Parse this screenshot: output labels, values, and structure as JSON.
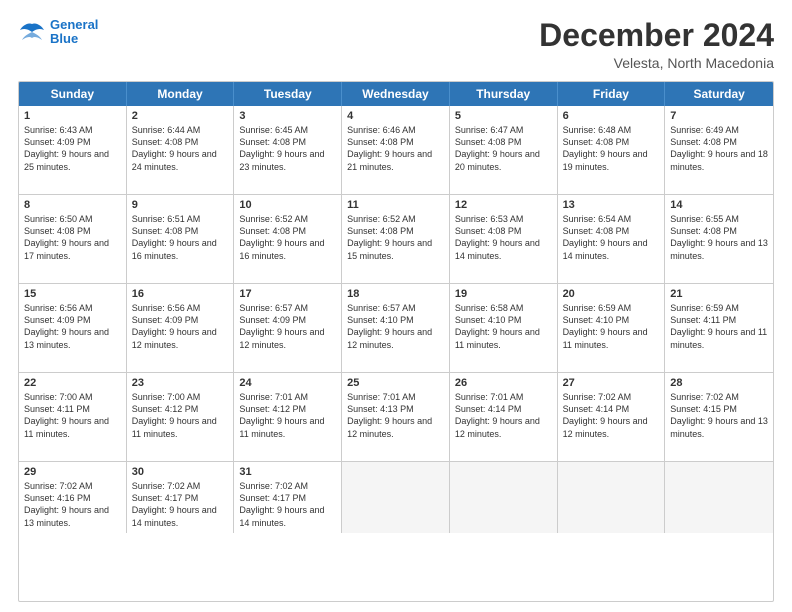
{
  "logo": {
    "line1": "General",
    "line2": "Blue"
  },
  "title": "December 2024",
  "subtitle": "Velesta, North Macedonia",
  "days": [
    "Sunday",
    "Monday",
    "Tuesday",
    "Wednesday",
    "Thursday",
    "Friday",
    "Saturday"
  ],
  "weeks": [
    [
      {
        "day": "1",
        "sunrise": "6:43 AM",
        "sunset": "4:09 PM",
        "daylight": "9 hours and 25 minutes."
      },
      {
        "day": "2",
        "sunrise": "6:44 AM",
        "sunset": "4:08 PM",
        "daylight": "9 hours and 24 minutes."
      },
      {
        "day": "3",
        "sunrise": "6:45 AM",
        "sunset": "4:08 PM",
        "daylight": "9 hours and 23 minutes."
      },
      {
        "day": "4",
        "sunrise": "6:46 AM",
        "sunset": "4:08 PM",
        "daylight": "9 hours and 21 minutes."
      },
      {
        "day": "5",
        "sunrise": "6:47 AM",
        "sunset": "4:08 PM",
        "daylight": "9 hours and 20 minutes."
      },
      {
        "day": "6",
        "sunrise": "6:48 AM",
        "sunset": "4:08 PM",
        "daylight": "9 hours and 19 minutes."
      },
      {
        "day": "7",
        "sunrise": "6:49 AM",
        "sunset": "4:08 PM",
        "daylight": "9 hours and 18 minutes."
      }
    ],
    [
      {
        "day": "8",
        "sunrise": "6:50 AM",
        "sunset": "4:08 PM",
        "daylight": "9 hours and 17 minutes."
      },
      {
        "day": "9",
        "sunrise": "6:51 AM",
        "sunset": "4:08 PM",
        "daylight": "9 hours and 16 minutes."
      },
      {
        "day": "10",
        "sunrise": "6:52 AM",
        "sunset": "4:08 PM",
        "daylight": "9 hours and 16 minutes."
      },
      {
        "day": "11",
        "sunrise": "6:52 AM",
        "sunset": "4:08 PM",
        "daylight": "9 hours and 15 minutes."
      },
      {
        "day": "12",
        "sunrise": "6:53 AM",
        "sunset": "4:08 PM",
        "daylight": "9 hours and 14 minutes."
      },
      {
        "day": "13",
        "sunrise": "6:54 AM",
        "sunset": "4:08 PM",
        "daylight": "9 hours and 14 minutes."
      },
      {
        "day": "14",
        "sunrise": "6:55 AM",
        "sunset": "4:08 PM",
        "daylight": "9 hours and 13 minutes."
      }
    ],
    [
      {
        "day": "15",
        "sunrise": "6:56 AM",
        "sunset": "4:09 PM",
        "daylight": "9 hours and 13 minutes."
      },
      {
        "day": "16",
        "sunrise": "6:56 AM",
        "sunset": "4:09 PM",
        "daylight": "9 hours and 12 minutes."
      },
      {
        "day": "17",
        "sunrise": "6:57 AM",
        "sunset": "4:09 PM",
        "daylight": "9 hours and 12 minutes."
      },
      {
        "day": "18",
        "sunrise": "6:57 AM",
        "sunset": "4:10 PM",
        "daylight": "9 hours and 12 minutes."
      },
      {
        "day": "19",
        "sunrise": "6:58 AM",
        "sunset": "4:10 PM",
        "daylight": "9 hours and 11 minutes."
      },
      {
        "day": "20",
        "sunrise": "6:59 AM",
        "sunset": "4:10 PM",
        "daylight": "9 hours and 11 minutes."
      },
      {
        "day": "21",
        "sunrise": "6:59 AM",
        "sunset": "4:11 PM",
        "daylight": "9 hours and 11 minutes."
      }
    ],
    [
      {
        "day": "22",
        "sunrise": "7:00 AM",
        "sunset": "4:11 PM",
        "daylight": "9 hours and 11 minutes."
      },
      {
        "day": "23",
        "sunrise": "7:00 AM",
        "sunset": "4:12 PM",
        "daylight": "9 hours and 11 minutes."
      },
      {
        "day": "24",
        "sunrise": "7:01 AM",
        "sunset": "4:12 PM",
        "daylight": "9 hours and 11 minutes."
      },
      {
        "day": "25",
        "sunrise": "7:01 AM",
        "sunset": "4:13 PM",
        "daylight": "9 hours and 12 minutes."
      },
      {
        "day": "26",
        "sunrise": "7:01 AM",
        "sunset": "4:14 PM",
        "daylight": "9 hours and 12 minutes."
      },
      {
        "day": "27",
        "sunrise": "7:02 AM",
        "sunset": "4:14 PM",
        "daylight": "9 hours and 12 minutes."
      },
      {
        "day": "28",
        "sunrise": "7:02 AM",
        "sunset": "4:15 PM",
        "daylight": "9 hours and 13 minutes."
      }
    ],
    [
      {
        "day": "29",
        "sunrise": "7:02 AM",
        "sunset": "4:16 PM",
        "daylight": "9 hours and 13 minutes."
      },
      {
        "day": "30",
        "sunrise": "7:02 AM",
        "sunset": "4:17 PM",
        "daylight": "9 hours and 14 minutes."
      },
      {
        "day": "31",
        "sunrise": "7:02 AM",
        "sunset": "4:17 PM",
        "daylight": "9 hours and 14 minutes."
      },
      null,
      null,
      null,
      null
    ]
  ]
}
